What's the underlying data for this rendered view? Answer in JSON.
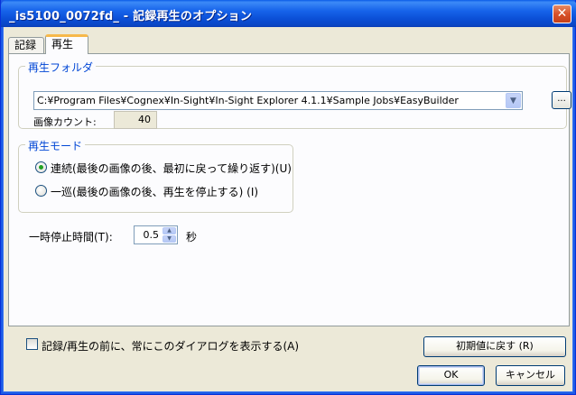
{
  "window": {
    "title": "_is5100_0072fd_ - 記録再生のオプション",
    "close_label": "✕"
  },
  "tabs": [
    {
      "label": "記録",
      "selected": false
    },
    {
      "label": "再生",
      "selected": true
    }
  ],
  "playback_folder": {
    "group_label": "再生フォルダ",
    "path": "C:¥Program Files¥Cognex¥In-Sight¥In-Sight Explorer 4.1.1¥Sample Jobs¥EasyBuilder",
    "browse_label": "...",
    "image_count_label": "画像カウント:",
    "image_count_value": "40"
  },
  "playback_mode": {
    "group_label": "再生モード",
    "options": [
      {
        "label": "連続(最後の画像の後、最初に戻って繰り返す)(U)",
        "checked": true
      },
      {
        "label": "一巡(最後の画像の後、再生を停止する) (I)",
        "checked": false
      }
    ]
  },
  "pause_time": {
    "label": "一時停止時間(T):",
    "value": "0.5",
    "unit": "秒"
  },
  "footer": {
    "show_dialog_label": "記録/再生の前に、常にこのダイアログを表示する(A)",
    "show_dialog_checked": false,
    "reset_label": "初期値に戻す (R)",
    "ok_label": "OK",
    "cancel_label": "キャンセル"
  },
  "colors": {
    "titlebar": "#0a5ce8",
    "group_label": "#0046d5",
    "radio_dot": "#21a121",
    "tab_highlight": "#f7b94b"
  },
  "icons": {
    "combo_arrow": "chevron-down-icon",
    "spin_up": "chevron-up-icon",
    "spin_down": "chevron-down-icon",
    "close": "close-icon"
  }
}
